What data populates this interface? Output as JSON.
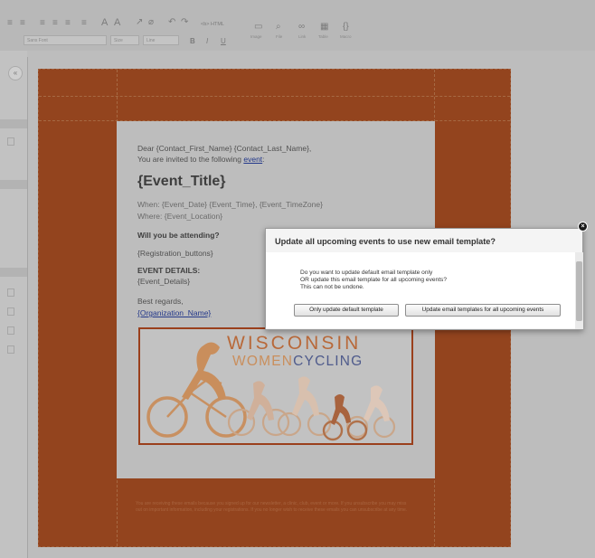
{
  "toolbar": {
    "html_button": "<b> HTML",
    "font_dropdown": "Sans Font",
    "size_dropdown": "Size",
    "line_dropdown": "Line",
    "bold": "B",
    "italic": "I",
    "underline": "U",
    "image_label": "Image",
    "file_label": "File",
    "link_label": "Link",
    "table_label": "Table",
    "macro_label": "Macro"
  },
  "email": {
    "greeting": "Dear {Contact_First_Name} {Contact_Last_Name},",
    "invite_prefix": "You are invited to the following ",
    "invite_link": "event",
    "invite_suffix": ":",
    "event_title": "{Event_Title}",
    "when_line": "When: {Event_Date} {Event_Time}, {Event_TimeZone}",
    "where_line": "Where: {Event_Location}",
    "attending_question": "Will you be attending?",
    "registration_buttons": "{Registration_buttons}",
    "event_details_heading": "EVENT DETAILS:",
    "event_details": "{Event_Details}",
    "closing": "Best regards,",
    "organization": "{Organization_Name}",
    "logo_line1": "WISCONSIN",
    "logo_line2a": "WOMEN",
    "logo_line2b": "CYCLING",
    "footer_text": "You are receiving these emails because you signed up for our newsletter, a clinic, club, event or more. If you unsubscribe you may miss out on important information, including your registrations. If you no longer wish to receive these emails you can unsubscribe at any time."
  },
  "dialog": {
    "title": "Update all upcoming events to use new email template?",
    "message_line1": "Do you want to update default email template only",
    "message_line2": "OR update this email template for all upcoming events?",
    "message_line3": "This can not be undone.",
    "button_default_only": "Only update default template",
    "button_all_events": "Update email templates for all upcoming events",
    "close_symbol": "×"
  },
  "colors": {
    "email_background": "#93441e",
    "dialog_background": "#f4f4f4",
    "link": "#23388a",
    "logo_orange": "#b8693a",
    "logo_blue": "#4f5b8c"
  },
  "icons": [
    "align-left-icon",
    "align-center-icon",
    "align-right-icon",
    "justify-icon",
    "list-icon",
    "font-color-icon",
    "background-color-icon",
    "format-painter-icon",
    "clear-format-icon",
    "undo-icon",
    "redo-icon",
    "image-icon",
    "paperclip-icon",
    "link-icon",
    "table-icon",
    "braces-icon",
    "chevron-left-icon",
    "close-icon"
  ]
}
